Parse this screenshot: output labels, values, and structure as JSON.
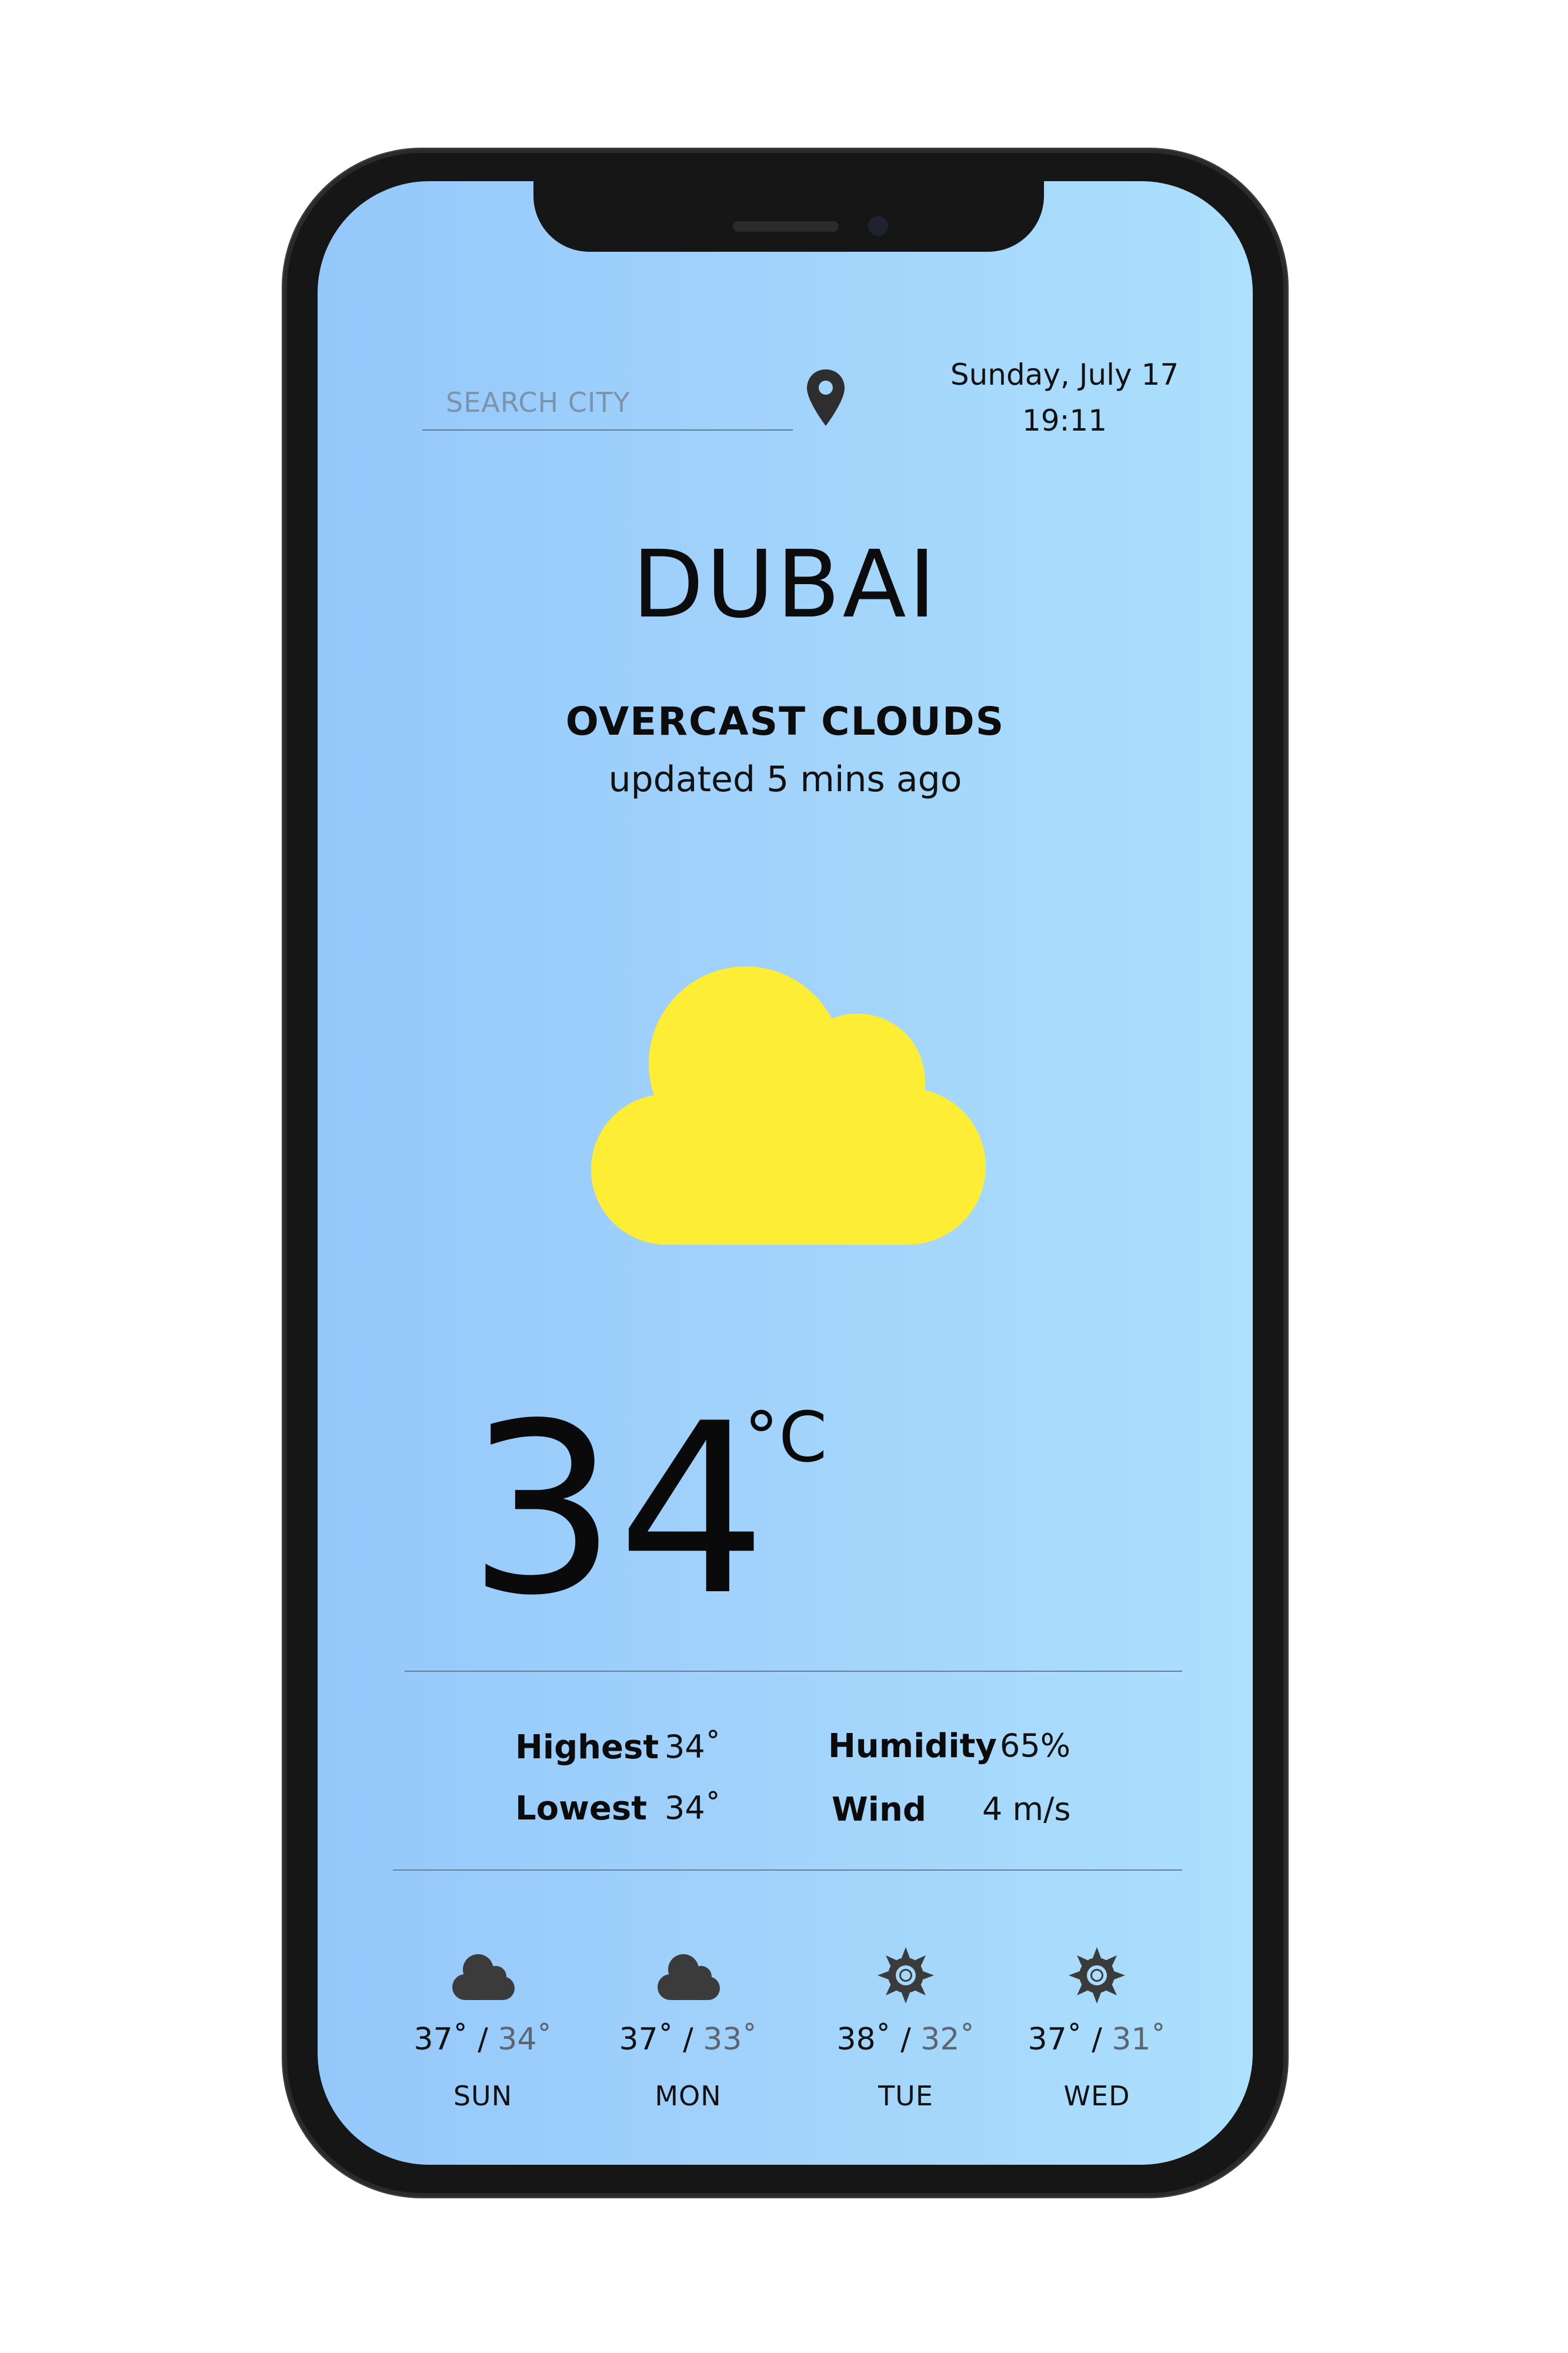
{
  "search": {
    "placeholder": "SEARCH CITY"
  },
  "header": {
    "date": "Sunday, July 17",
    "time": "19:11"
  },
  "location": {
    "city": "DUBAI"
  },
  "weather": {
    "condition": "OVERCAST CLOUDS",
    "updated": "updated 5 mins ago",
    "icon": "cloud-icon",
    "icon_color": "#fdee35"
  },
  "temperature": {
    "value": "34",
    "unit": "°C"
  },
  "stats": {
    "highest_label": "Highest",
    "highest_value": "34˚",
    "lowest_label": "Lowest",
    "lowest_value": "34˚",
    "humidity_label": "Humidity",
    "humidity_value": "65%",
    "wind_label": "Wind",
    "wind_value": "4 m/s"
  },
  "forecast": [
    {
      "day": "SUN",
      "high": "37˚",
      "low": "34˚",
      "icon": "cloud-icon"
    },
    {
      "day": "MON",
      "high": "37˚",
      "low": "33˚",
      "icon": "cloud-icon"
    },
    {
      "day": "TUE",
      "high": "38˚",
      "low": "32˚",
      "icon": "sun-icon"
    },
    {
      "day": "WED",
      "high": "37˚",
      "low": "31˚",
      "icon": "sun-icon"
    }
  ],
  "colors": {
    "screen_gradient_left": "#94c8fb",
    "screen_gradient_right": "#ace0fc",
    "forecast_icon": "#3b3b3b",
    "low_temp": "#5d6670"
  }
}
